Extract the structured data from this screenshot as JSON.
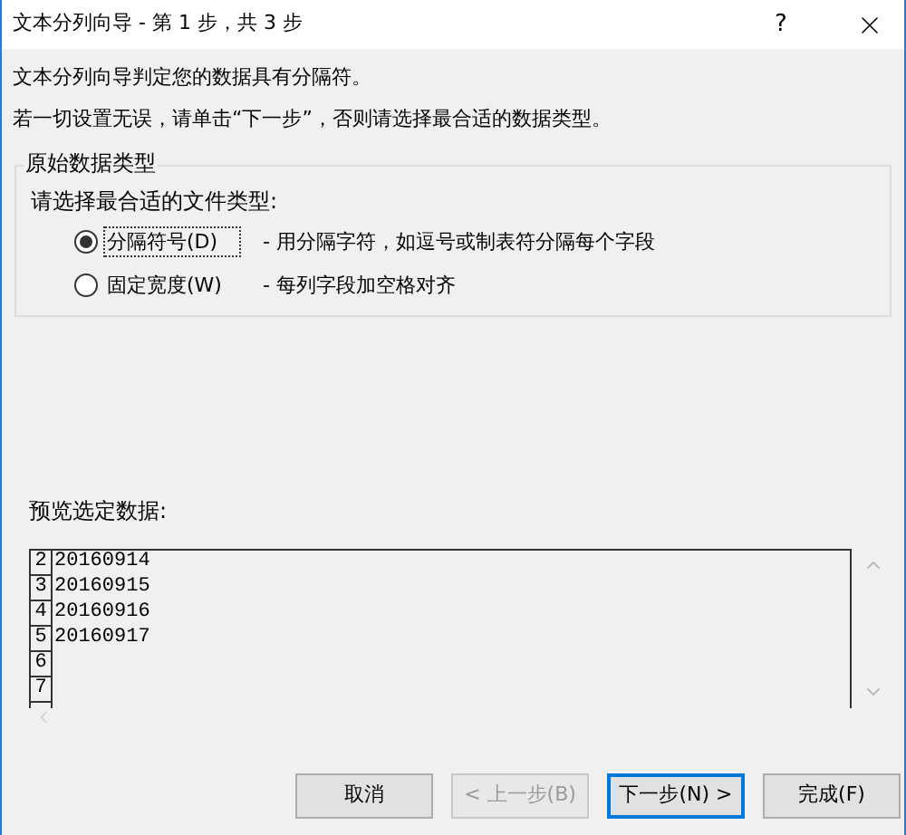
{
  "window": {
    "title": "文本分列向导 - 第 1 步，共 3 步",
    "help": "?"
  },
  "intro": [
    "文本分列向导判定您的数据具有分隔符。",
    "若一切设置无误，请单击“下一步”，否则请选择最合适的数据类型。"
  ],
  "group": {
    "title": "原始数据类型",
    "prompt": "请选择最合适的文件类型:",
    "options": [
      {
        "label": "分隔符号(D)",
        "description": "- 用分隔字符，如逗号或制表符分隔每个字段",
        "selected": true
      },
      {
        "label": "固定宽度(W)",
        "description": "- 每列字段加空格对齐",
        "selected": false
      }
    ]
  },
  "preview": {
    "label": "预览选定数据:",
    "rows": [
      {
        "number": "2",
        "text": "20160914"
      },
      {
        "number": "3",
        "text": "20160915"
      },
      {
        "number": "4",
        "text": "20160916"
      },
      {
        "number": "5",
        "text": "20160917"
      },
      {
        "number": "6"
      },
      {
        "number": "7"
      }
    ]
  },
  "buttons": [
    {
      "label": "取消",
      "disabled": false,
      "default": false
    },
    {
      "label": "< 上一步(B)",
      "disabled": true,
      "default": false
    },
    {
      "label": "下一步(N) >",
      "disabled": false,
      "default": true
    },
    {
      "label": "完成(F)",
      "disabled": false,
      "default": false
    }
  ]
}
